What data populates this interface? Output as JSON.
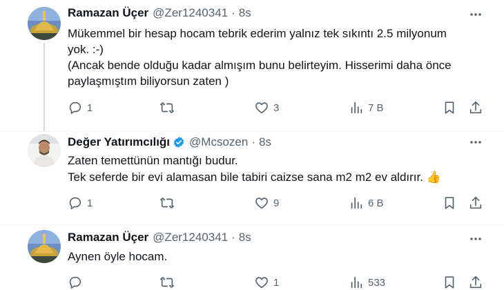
{
  "tweets": [
    {
      "name": "Ramazan Üçer",
      "handle": "@Zer1240341",
      "dot": "·",
      "time": "8s",
      "lines": [
        "Mükemmel bir hesap hocam tebrik ederim yalnız tek sıkıntı 2.5 milyonum",
        "yok. :-)",
        "(Ancak bende olduğu kadar almışım bunu belirteyim. Hisserimi daha önce",
        "paylaşmıştım biliyorsun zaten )"
      ],
      "replies": "1",
      "retweets": "",
      "likes": "3",
      "views": "7 B"
    },
    {
      "name": "Değer Yatırımcılığı",
      "verified": true,
      "handle": "@Mcsozen",
      "dot": "·",
      "time": "8s",
      "lines": [
        "Zaten temettünün mantığı budur.",
        "Tek seferde bir evi alamasan bile tabiri caizse sana m2 m2 ev aldırır. 👍"
      ],
      "replies": "1",
      "retweets": "",
      "likes": "9",
      "views": "6 B"
    },
    {
      "name": "Ramazan Üçer",
      "handle": "@Zer1240341",
      "dot": "·",
      "time": "8s",
      "lines": [
        "Aynen öyle hocam."
      ],
      "replies": "",
      "retweets": "",
      "likes": "1",
      "views": "533"
    }
  ],
  "icons": {
    "more": "more-dots-icon",
    "reply": "reply-icon",
    "retweet": "retweet-icon",
    "like": "like-icon",
    "views": "views-icon",
    "bookmark": "bookmark-icon",
    "share": "share-icon",
    "verified": "verified-badge-icon"
  },
  "colors": {
    "text": "#0f1419",
    "secondary": "#536471",
    "verified": "#1d9bf0",
    "divider": "#eff3f4"
  }
}
